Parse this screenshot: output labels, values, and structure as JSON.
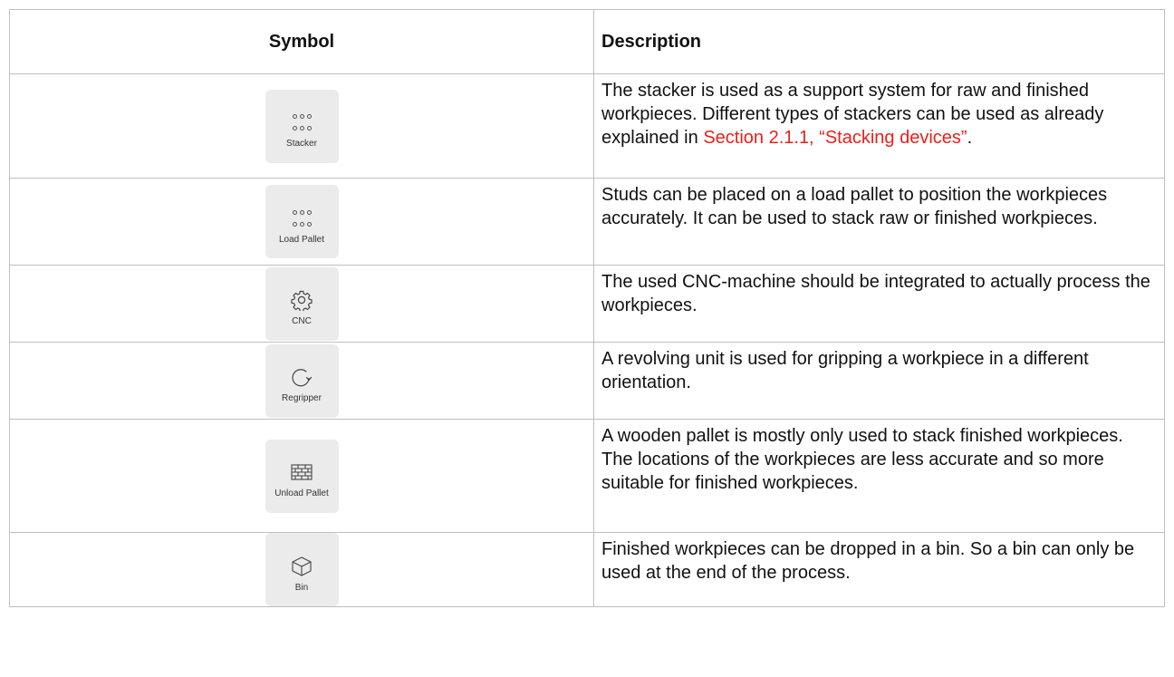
{
  "table": {
    "headers": {
      "symbol": "Symbol",
      "description": "Description"
    },
    "rows": [
      {
        "icon": "stacker-icon",
        "label": "Stacker",
        "description_pre": "The stacker is used as a support system for raw and finished workpieces. Different types of stackers can be used as already explained in ",
        "link": "Section 2.1.1, “Stacking devices”",
        "description_post": "."
      },
      {
        "icon": "load-pallet-icon",
        "label": "Load Pallet",
        "description": "Studs can be placed on a load pallet to position the workpieces accurately. It can be used to stack raw or finished workpieces."
      },
      {
        "icon": "gear-icon",
        "label": "CNC",
        "description": "The used CNC-machine should be integrated to actually process the workpieces."
      },
      {
        "icon": "rotate-icon",
        "label": "Regripper",
        "description": "A revolving unit is used for gripping a workpiece in a different orientation."
      },
      {
        "icon": "pallet-grid-icon",
        "label": "Unload Pallet",
        "description": "A wooden pallet is mostly only used to stack finished workpieces. The locations of the workpieces are less accurate and so more suitable for finished workpieces."
      },
      {
        "icon": "box-icon",
        "label": "Bin",
        "description": "Finished workpieces can be dropped in a bin. So a bin can only be used at the end of the process."
      }
    ],
    "link_color": "#e8211b",
    "tile_color": "#ebebeb"
  }
}
